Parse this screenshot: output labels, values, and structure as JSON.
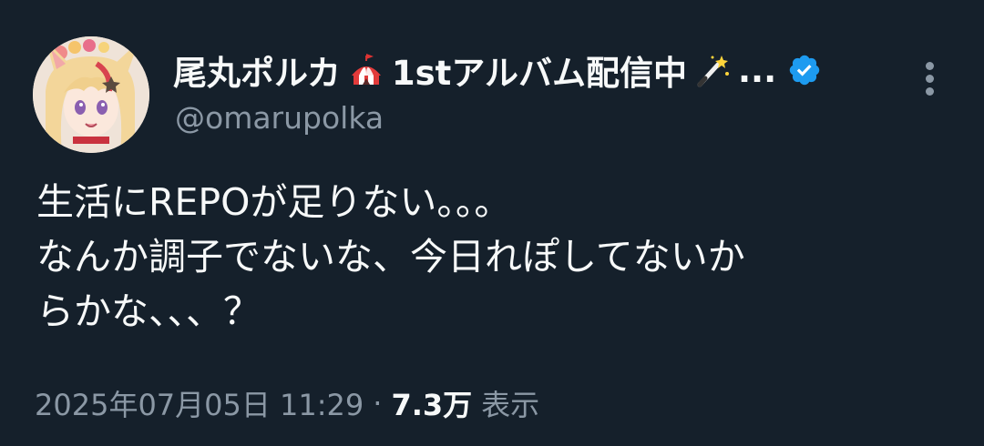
{
  "author": {
    "display_name_prefix": "尾丸ポルカ",
    "display_name_middle": "1stアルバム配信中",
    "display_name_ellipsis": "...",
    "circus_emoji": "circus-tent-icon",
    "wand_emoji": "magic-wand-icon",
    "verified_icon": "verified-badge-icon",
    "handle": "@omarupolka"
  },
  "tweet": {
    "lines": [
      "生活にREPOが足りない。。。",
      "なんか調子でないな、今日れぽしてないか",
      "らかな、、、？"
    ]
  },
  "meta": {
    "timestamp": "2025年07月05日 11:29",
    "separator": "·",
    "views_count": "7.3万",
    "views_label": "表示"
  },
  "colors": {
    "background": "#15202b",
    "text_primary": "#f7f9f9",
    "text_secondary": "#8b98a5",
    "verified_blue": "#1d9bf0"
  }
}
